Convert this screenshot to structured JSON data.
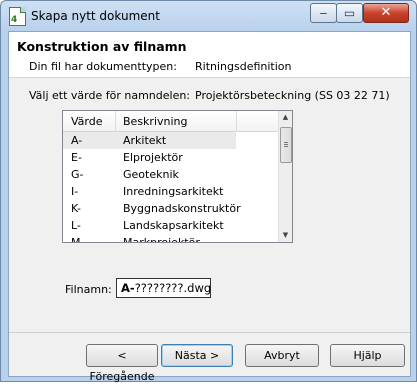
{
  "window": {
    "title": "Skapa nytt dokument",
    "app_icon_digit": "4"
  },
  "header": {
    "title": "Konstruktion av filnamn",
    "doctype_label": "Din fil har dokumenttypen:",
    "doctype_value": "Ritningsdefinition"
  },
  "namepart": {
    "label": "Välj ett värde för namndelen:",
    "value": "Projektörsbeteckning (SS 03 22 71)"
  },
  "list": {
    "columns": [
      "Värde",
      "Beskrivning"
    ],
    "rows": [
      {
        "value": "A-",
        "description": "Arkitekt",
        "selected": true
      },
      {
        "value": "E-",
        "description": "Elprojektör",
        "selected": false
      },
      {
        "value": "G-",
        "description": "Geoteknik",
        "selected": false
      },
      {
        "value": "I-",
        "description": "Inredningsarkitekt",
        "selected": false
      },
      {
        "value": "K-",
        "description": "Byggnadskonstruktör",
        "selected": false
      },
      {
        "value": "L-",
        "description": "Landskapsarkitekt",
        "selected": false
      },
      {
        "value": "M-",
        "description": "Markprojektör",
        "selected": false
      }
    ]
  },
  "filename": {
    "label": "Filnamn:",
    "prefix": "A-",
    "rest": "????????.dwg"
  },
  "buttons": {
    "prev": "< Föregående",
    "next": "Nästa >",
    "cancel": "Avbryt",
    "help": "Hjälp"
  },
  "icons": {
    "app": "document-app-icon",
    "minimize": "minimize-icon",
    "maximize": "maximize-icon",
    "close": "close-icon"
  },
  "colors": {
    "title_bar": "#b9d1ec",
    "close_button": "#c8432c",
    "selected_row": "#eaeaea"
  }
}
